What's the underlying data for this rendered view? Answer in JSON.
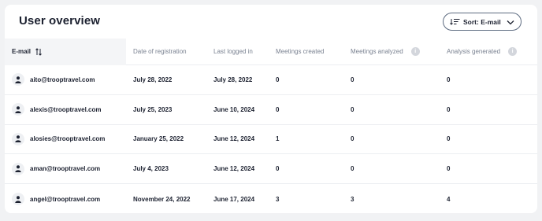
{
  "header": {
    "title": "User overview",
    "sort_label": "Sort: E-mail"
  },
  "table": {
    "columns": {
      "email": "E-mail",
      "registration": "Date of registration",
      "last_login": "Last logged in",
      "meetings_created": "Meetings created",
      "meetings_analyzed": "Meetings analyzed",
      "analysis_generated": "Analysis generated"
    },
    "info_glyph": "i",
    "rows": [
      {
        "email": "aito@trooptravel.com",
        "registration": "July 28, 2022",
        "last_login": "July 28, 2022",
        "meetings_created": "0",
        "meetings_analyzed": "0",
        "analysis_generated": "0"
      },
      {
        "email": "alexis@trooptravel.com",
        "registration": "July 25, 2023",
        "last_login": "June 10, 2024",
        "meetings_created": "0",
        "meetings_analyzed": "0",
        "analysis_generated": "0"
      },
      {
        "email": "alosies@trooptravel.com",
        "registration": "January 25, 2022",
        "last_login": "June 12, 2024",
        "meetings_created": "1",
        "meetings_analyzed": "0",
        "analysis_generated": "0"
      },
      {
        "email": "aman@trooptravel.com",
        "registration": "July 4, 2023",
        "last_login": "June 12, 2024",
        "meetings_created": "0",
        "meetings_analyzed": "0",
        "analysis_generated": "0"
      },
      {
        "email": "angel@trooptravel.com",
        "registration": "November 24, 2022",
        "last_login": "June 17, 2024",
        "meetings_created": "3",
        "meetings_analyzed": "3",
        "analysis_generated": "4"
      }
    ]
  },
  "colors": {
    "background": "#f1f2f4",
    "card": "#ffffff",
    "text": "#1c2130",
    "muted": "#7a8291",
    "border": "#5d6b80",
    "header_cell": "#f4f5f7"
  }
}
